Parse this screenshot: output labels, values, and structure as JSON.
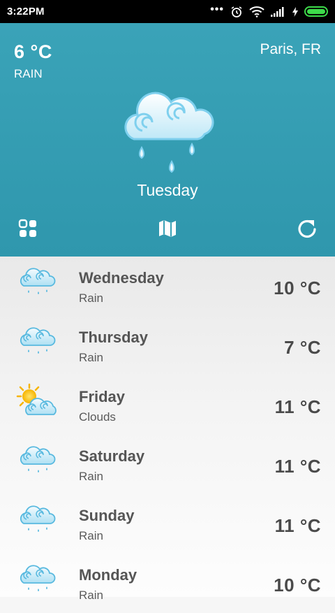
{
  "status_bar": {
    "time": "3:22PM",
    "icons": [
      "more-dots-icon",
      "alarm-icon",
      "wifi-icon",
      "signal-icon",
      "charging-icon",
      "battery-icon"
    ]
  },
  "current": {
    "temperature": "6 °C",
    "condition": "RAIN",
    "location": "Paris, FR",
    "day": "Tuesday",
    "icon": "rain-cloud-icon"
  },
  "toolbar": {
    "left_icon": "grid-icon",
    "center_icon": "map-icon",
    "right_icon": "refresh-icon"
  },
  "colors": {
    "header_bg": "#36a0b5",
    "battery": "#3ddb4a",
    "text_dark": "#4a4a4a"
  },
  "forecast": [
    {
      "day": "Wednesday",
      "condition": "Rain",
      "temperature": "10 °C",
      "icon": "rain-cloud-icon"
    },
    {
      "day": "Thursday",
      "condition": "Rain",
      "temperature": "7 °C",
      "icon": "rain-cloud-icon"
    },
    {
      "day": "Friday",
      "condition": "Clouds",
      "temperature": "11 °C",
      "icon": "sun-cloud-icon"
    },
    {
      "day": "Saturday",
      "condition": "Rain",
      "temperature": "11 °C",
      "icon": "rain-cloud-icon"
    },
    {
      "day": "Sunday",
      "condition": "Rain",
      "temperature": "11 °C",
      "icon": "rain-cloud-icon"
    },
    {
      "day": "Monday",
      "condition": "Rain",
      "temperature": "10 °C",
      "icon": "rain-cloud-icon"
    }
  ]
}
